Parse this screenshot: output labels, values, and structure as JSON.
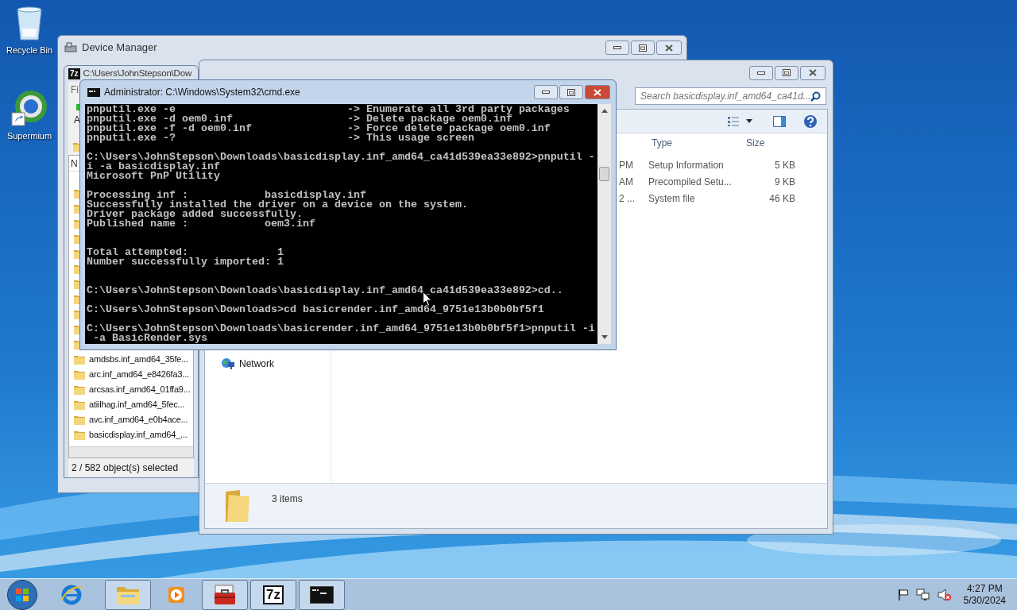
{
  "desktop_icons": [
    {
      "label": "Recycle Bin",
      "kind": "recycle"
    },
    {
      "label": "Supermium",
      "kind": "browser"
    }
  ],
  "device_manager": {
    "title": "Device Manager",
    "active": false
  },
  "archive_window": {
    "logo_text": "7z",
    "title": "C:\\Users\\JohnStepson\\Dow",
    "menu": "Fi",
    "toolbar_label": "A",
    "column_header": "N",
    "rows": [
      "amdsbs.inf_amd64_35fe...",
      "arc.inf_amd64_e8426fa3...",
      "arcsas.inf_amd64_01ffa9...",
      "atiilhag.inf_amd64_5fec...",
      "avc.inf_amd64_e0b4ace...",
      "basicdisplay.inf_amd64_..."
    ],
    "status": "2 / 582 object(s) selected"
  },
  "explorer": {
    "active": false,
    "search": {
      "placeholder": "Search basicdisplay.inf_amd64_ca41d..."
    },
    "columns": [
      "Type",
      "Size"
    ],
    "rows": [
      {
        "date": "PM",
        "type": "Setup Information",
        "size": "5 KB"
      },
      {
        "date": "AM",
        "type": "Precompiled Setu...",
        "size": "9 KB"
      },
      {
        "date": "2 ...",
        "type": "System file",
        "size": "46 KB"
      }
    ],
    "nav": [
      {
        "label": "Network"
      }
    ],
    "details": "3 items"
  },
  "console": {
    "active": true,
    "title": "Administrator: C:\\Windows\\System32\\cmd.exe",
    "text": "pnputil.exe -e                           -> Enumerate all 3rd party packages\npnputil.exe -d oem0.inf                  -> Delete package oem0.inf\npnputil.exe -f -d oem0.inf               -> Force delete package oem0.inf\npnputil.exe -?                           -> This usage screen\n\nC:\\Users\\JohnStepson\\Downloads\\basicdisplay.inf_amd64_ca41d539ea33e892>pnputil -\ni -a basicdisplay.inf\nMicrosoft PnP Utility\n\nProcessing inf :            basicdisplay.inf\nSuccessfully installed the driver on a device on the system.\nDriver package added successfully.\nPublished name :            oem3.inf\n\n\nTotal attempted:              1\nNumber successfully imported: 1\n\n\nC:\\Users\\JohnStepson\\Downloads\\basicdisplay.inf_amd64_ca41d539ea33e892>cd..\n\nC:\\Users\\JohnStepson\\Downloads>cd basicrender.inf_amd64_9751e13b0b0bf5f1\n\nC:\\Users\\JohnStepson\\Downloads\\basicrender.inf_amd64_9751e13b0b0bf5f1>pnputil -i\n -a BasicRender.sys"
  },
  "taskbar": {
    "buttons": [
      {
        "kind": "ie",
        "open": false
      },
      {
        "kind": "explorer",
        "open": true
      },
      {
        "kind": "media",
        "open": false
      },
      {
        "kind": "toolbox",
        "open": true
      },
      {
        "kind": "archiver",
        "open": true,
        "logo_text": "7z"
      },
      {
        "kind": "console",
        "open": true
      }
    ],
    "tray": [
      {
        "kind": "flag"
      },
      {
        "kind": "network"
      },
      {
        "kind": "volume-muted"
      }
    ],
    "clock": {
      "time": "4:27 PM",
      "date": "5/30/2024"
    }
  }
}
